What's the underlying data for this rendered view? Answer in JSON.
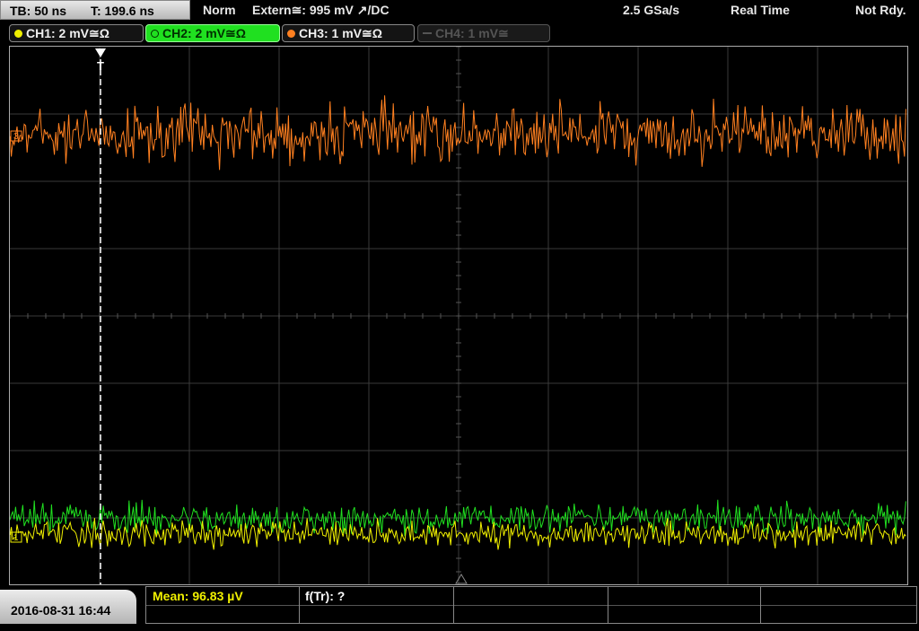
{
  "header": {
    "timebase": "TB: 50 ns",
    "trigger_time": "T: 199.6 ns",
    "trigger_mode": "Norm",
    "trigger_source": "Extern≅: 995 mV ↗/DC",
    "sample_rate": "2.5 GSa/s",
    "acq_mode": "Real Time",
    "status": "Not Rdy."
  },
  "channels": [
    {
      "label": "CH1: 2 mV≅Ω",
      "color": "#f0f000",
      "active": true
    },
    {
      "label": "CH2: 2 mV≅Ω",
      "color": "#20e020",
      "active": true
    },
    {
      "label": "CH3: 1 mV≅Ω",
      "color": "#ff8020",
      "active": true
    },
    {
      "label": "CH4: 1 mV≅",
      "color": "#555555",
      "active": false
    }
  ],
  "markers": {
    "trigger": "T",
    "ch3_offset": "3",
    "ch1_offset": "1"
  },
  "footer": {
    "datetime": "2016-08-31 16:44",
    "mean": "Mean: 96.83 µV",
    "freq": "f(Tr): ?"
  }
}
